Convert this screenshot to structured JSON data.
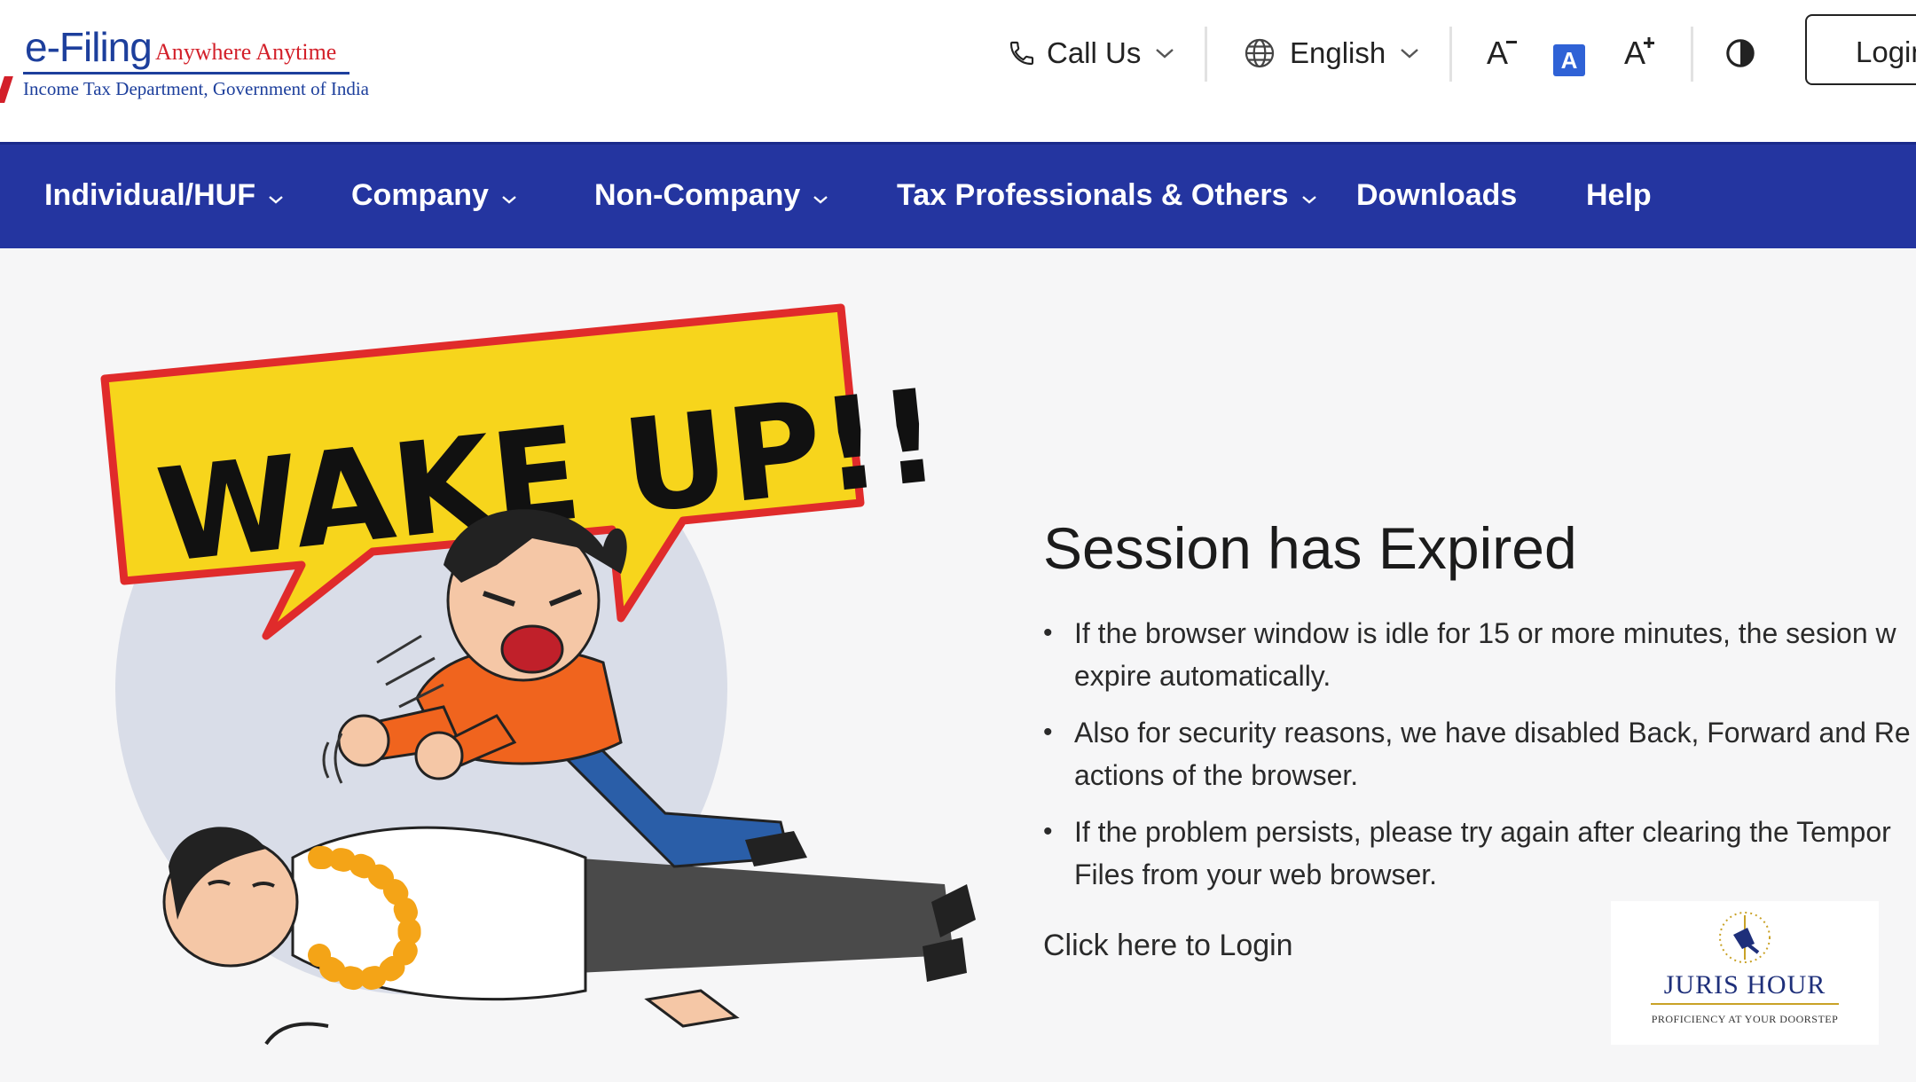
{
  "header": {
    "brand": "e-Filing",
    "tagline": "Anywhere Anytime",
    "department": "Income Tax Department, Government of India",
    "call_us": "Call Us",
    "language": "English",
    "font_decrease": "A",
    "font_normal": "A",
    "font_increase": "A",
    "login": "Login"
  },
  "nav": {
    "items": [
      {
        "label": "Individual/HUF",
        "dropdown": true
      },
      {
        "label": "Company",
        "dropdown": true
      },
      {
        "label": "Non-Company",
        "dropdown": true
      },
      {
        "label": "Tax Professionals & Others",
        "dropdown": true
      },
      {
        "label": "Downloads",
        "dropdown": false
      },
      {
        "label": "Help",
        "dropdown": false
      }
    ]
  },
  "illustration": {
    "banner_text": "WAKE UP!!"
  },
  "session": {
    "title": "Session has Expired",
    "bullets": [
      {
        "line1": "If the browser window is idle for 15 or more minutes, the sesion w",
        "line2": "expire automatically."
      },
      {
        "line1": "Also for security reasons, we have disabled Back, Forward and Re",
        "line2": "actions of the browser."
      },
      {
        "line1": "If the problem persists, please try again after clearing the Tempor",
        "line2": "Files from your web browser."
      }
    ],
    "login_link": "Click here to Login"
  },
  "watermark": {
    "name": "JURIS HOUR",
    "tagline": "PROFICIENCY AT YOUR DOORSTEP"
  },
  "colors": {
    "nav_bg": "#2435a0",
    "brand_blue": "#1d3f9c",
    "brand_red": "#d3202a",
    "banner_yellow": "#f7d51c"
  }
}
